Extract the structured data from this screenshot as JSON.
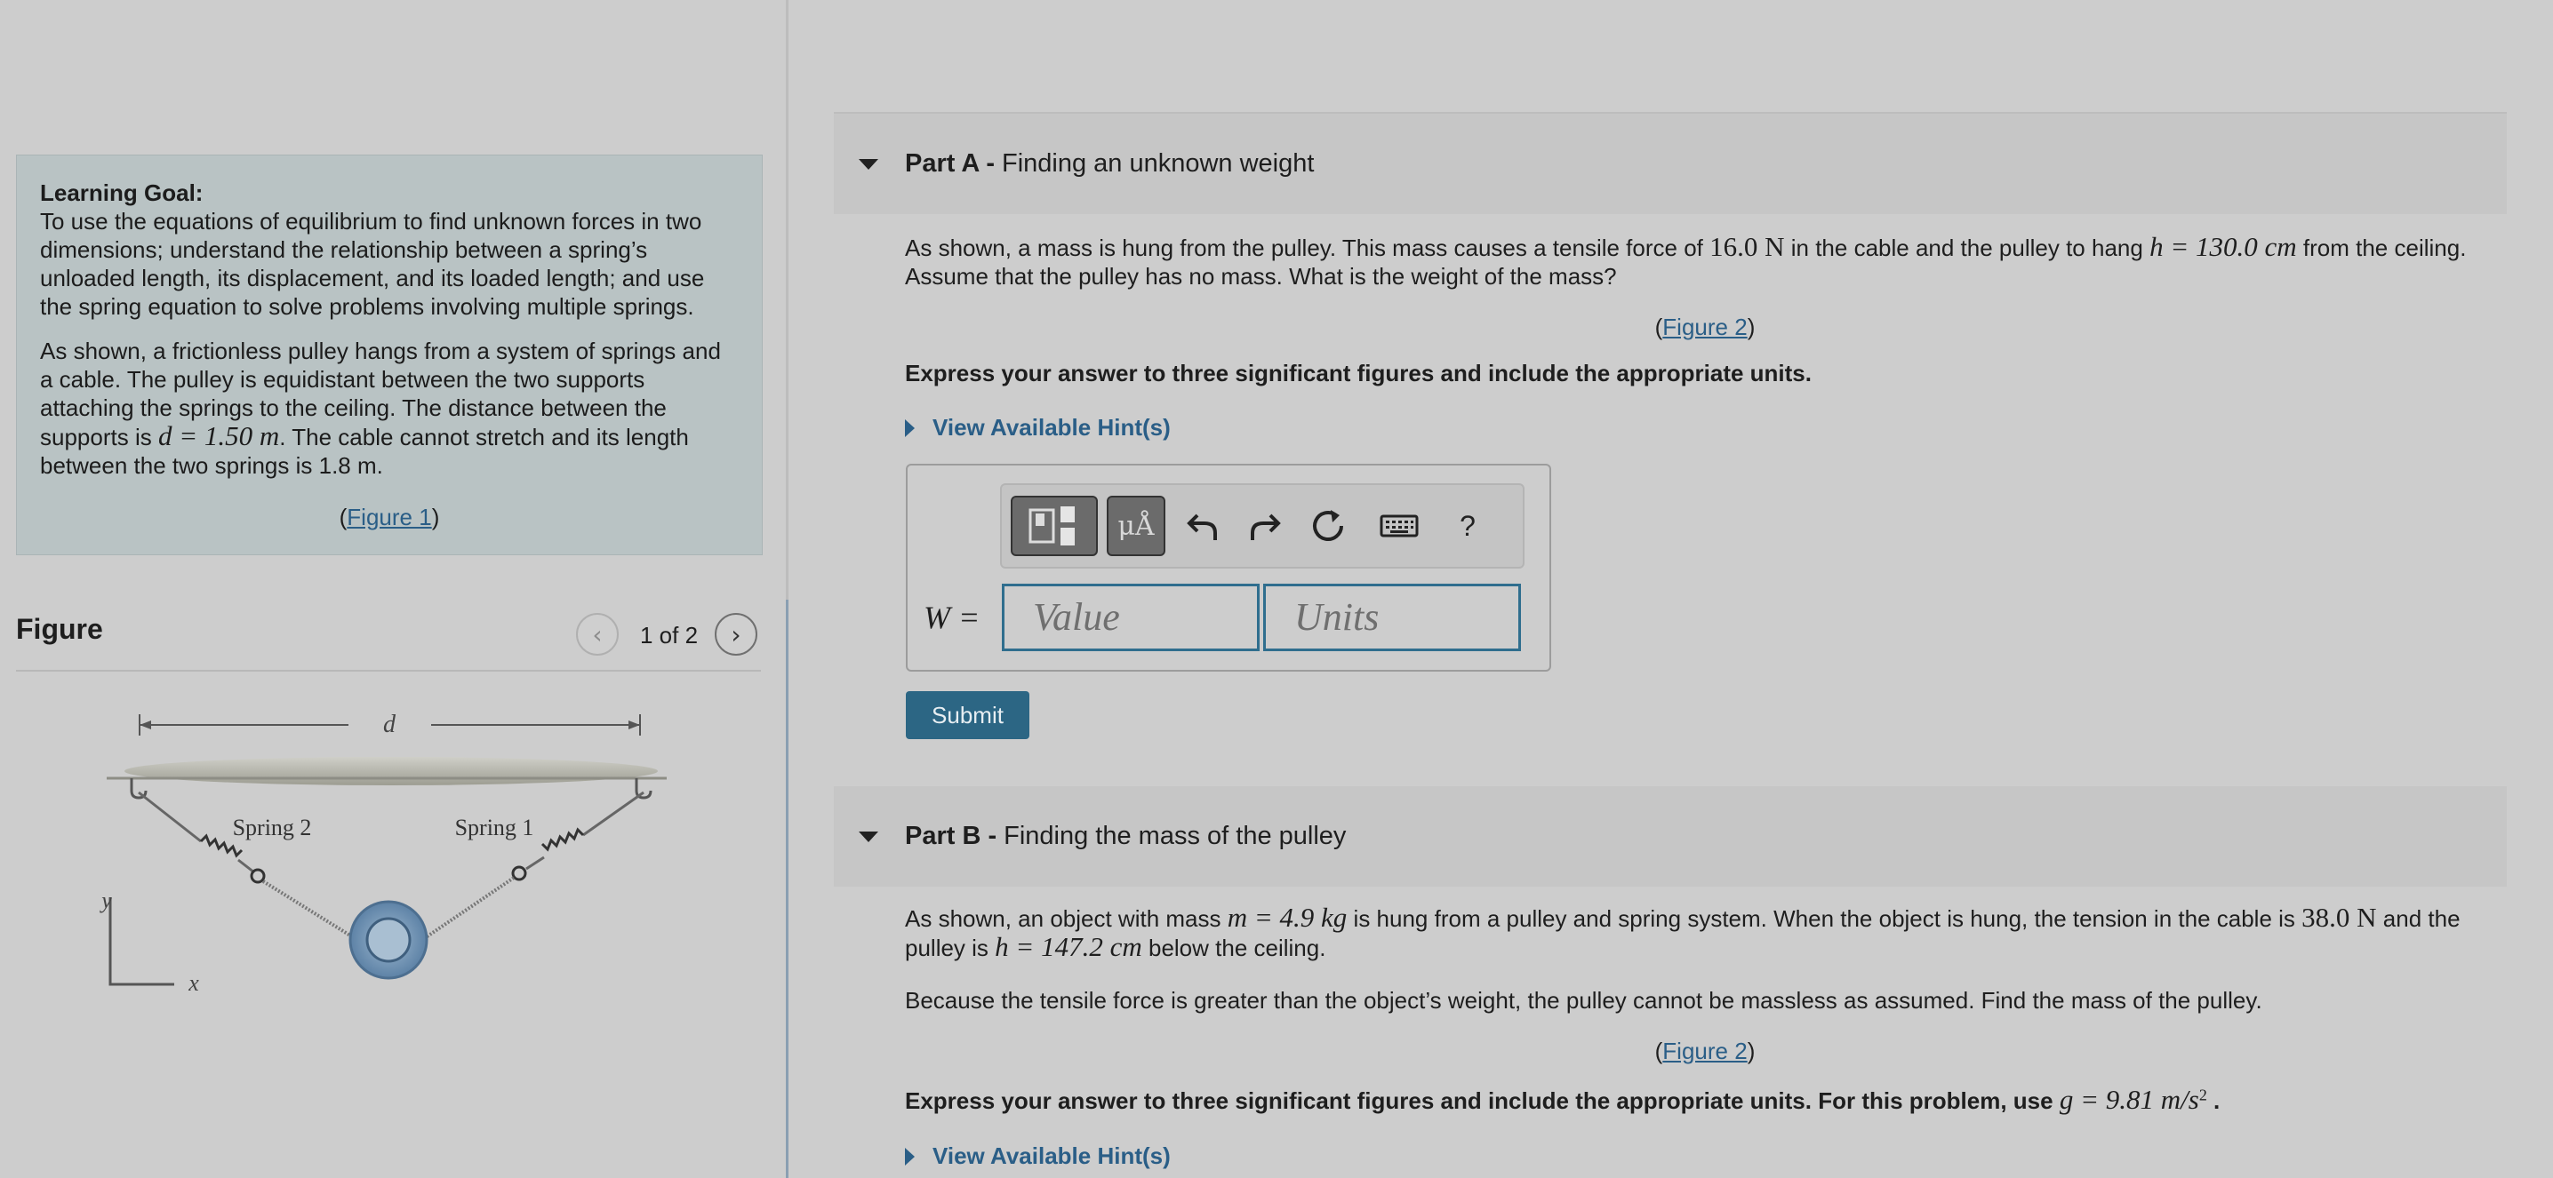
{
  "learning_goal": {
    "title": "Learning Goal:",
    "paragraph1": "To use the equations of equilibrium to find unknown forces in two dimensions; understand the relationship between a spring’s unloaded length, its displacement, and its loaded length; and use the spring equation to solve problems involving multiple springs.",
    "paragraph2_a": "As shown, a frictionless pulley hangs from a system of springs and a cable. The pulley is equidistant between the two supports attaching the springs to the ceiling. The distance between the supports is",
    "paragraph2_math": "d = 1.50 m",
    "paragraph2_b": ". The cable cannot stretch and its length between the two springs is 1.8 m.",
    "figure_link": "Figure 1"
  },
  "figure_panel": {
    "title": "Figure",
    "counter": "1 of 2",
    "prev_icon": "‹",
    "next_icon": "›",
    "diagram": {
      "dimension_label": "d",
      "spring_left_label": "Spring 2",
      "spring_right_label": "Spring 1",
      "axis_y": "y",
      "axis_x": "x"
    }
  },
  "part_a": {
    "label": "Part A -",
    "title": "Finding an unknown weight",
    "question_1": "As shown, a mass is hung from the pulley. This mass causes a tensile force of",
    "question_force": "16.0 N",
    "question_2": "in the cable and the pulley to hang",
    "question_height": "h = 130.0 cm",
    "question_3": "from the ceiling. Assume that the pulley has no mass. What is the weight of the mass?",
    "figure_link": "Figure 2",
    "instructions": "Express your answer to three significant figures and include the appropriate units.",
    "hint_label": "View Available Hint(s)",
    "answer_variable": "W =",
    "value_placeholder": "Value",
    "units_placeholder": "Units",
    "submit_label": "Submit",
    "toolbar": {
      "templates_icon": "templates-icon",
      "symbols_label": "μÅ",
      "undo_icon": "undo-icon",
      "redo_icon": "redo-icon",
      "reset_icon": "reset-icon",
      "keyboard_icon": "keyboard-icon",
      "help_label": "?"
    }
  },
  "part_b": {
    "label": "Part B -",
    "title": "Finding the mass of the pulley",
    "question_1": "As shown, an object with mass",
    "question_mass": "m = 4.9 kg",
    "question_2": "is hung from a pulley and spring system. When the object is hung, the tension in the cable is",
    "question_tension": "38.0 N",
    "question_3": "and the pulley is",
    "question_height": "h = 147.2 cm",
    "question_4": "below the ceiling.",
    "question_para2": "Because the tensile force is greater than the object’s weight, the pulley cannot be massless as assumed. Find the mass of the pulley.",
    "figure_link": "Figure 2",
    "instructions": "Express your answer to three significant figures and include the appropriate units. For this problem, use",
    "instructions_math": "g = 9.81 m/s",
    "instructions_exp": "2",
    "instructions_end": ".",
    "hint_label": "View Available Hint(s)"
  }
}
